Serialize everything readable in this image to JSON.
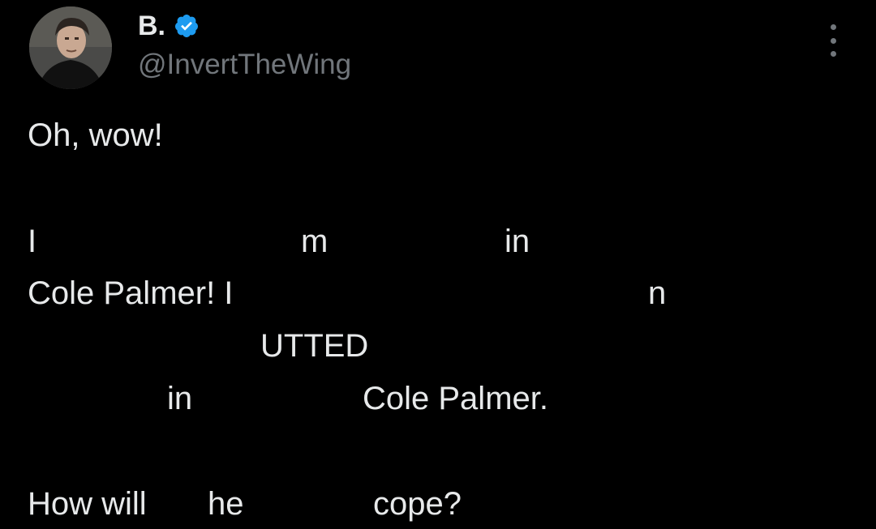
{
  "author": {
    "display_name": "B.",
    "handle": "@InvertTheWing",
    "verified": true,
    "verified_color": "#1d9bf0"
  },
  "menu": {
    "icon": "more-vertical-icon"
  },
  "tweet_text": {
    "line1": "Oh, wow!",
    "fragments": [
      "I",
      "m",
      "in",
      "Cole Palmer! I",
      "n",
      "UTTED",
      "in",
      "Cole Palmer.",
      "How will",
      "he",
      "cope?"
    ]
  },
  "colors": {
    "background": "#000000",
    "text": "#e7e9ea",
    "secondary": "#71767b"
  }
}
